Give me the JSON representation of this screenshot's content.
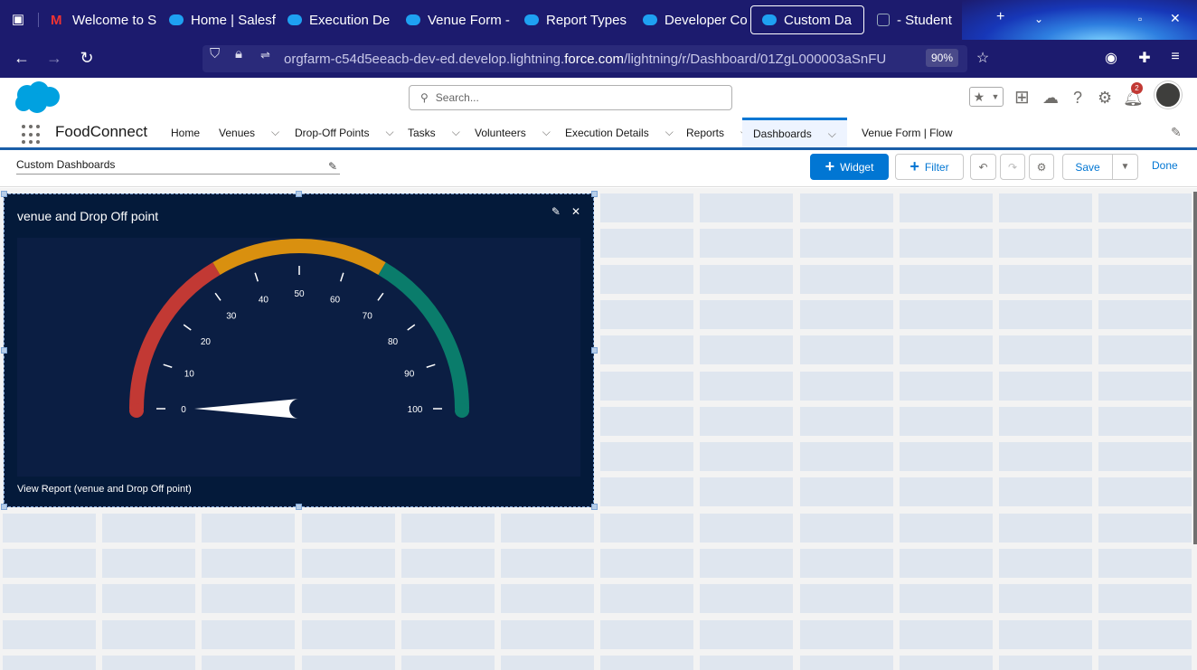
{
  "browser": {
    "tabs": [
      {
        "label": "Welcome to S",
        "icon": "gmail-icon"
      },
      {
        "label": "Home | Salesf",
        "icon": "salesforce-icon"
      },
      {
        "label": "Execution De",
        "icon": "salesforce-icon"
      },
      {
        "label": "Venue Form -",
        "icon": "salesforce-icon"
      },
      {
        "label": "Report Types",
        "icon": "salesforce-icon"
      },
      {
        "label": "Developer Co",
        "icon": "salesforce-icon"
      },
      {
        "label": "Custom Da",
        "icon": "salesforce-icon",
        "active": true
      },
      {
        "label": "- Student",
        "icon": "student-icon"
      }
    ],
    "url_prefix": "orgfarm-c54d5eeacb-dev-ed.develop.lightning.",
    "url_domain": "force.com",
    "url_suffix": "/lightning/r/Dashboard/01ZgL000003aSnFU",
    "zoom": "90%"
  },
  "header": {
    "search_placeholder": "Search...",
    "notification_count": "2"
  },
  "appnav": {
    "app_name": "FoodConnect",
    "items": [
      {
        "label": "Home",
        "dropdown": false
      },
      {
        "label": "Venues",
        "dropdown": true
      },
      {
        "label": "Drop-Off Points",
        "dropdown": true
      },
      {
        "label": "Tasks",
        "dropdown": true
      },
      {
        "label": "Volunteers",
        "dropdown": true
      },
      {
        "label": "Execution Details",
        "dropdown": true
      },
      {
        "label": "Reports",
        "dropdown": true
      },
      {
        "label": "Dashboards",
        "dropdown": true,
        "active": true
      },
      {
        "label": "Venue Form | Flow",
        "dropdown": false
      }
    ]
  },
  "toolbar": {
    "dashboard_name": "Custom Dashboards",
    "widget_label": "Widget",
    "filter_label": "Filter",
    "save_label": "Save",
    "done_label": "Done"
  },
  "widget": {
    "title": "venue and Drop Off point",
    "footer_link": "View Report (venue and Drop Off point)"
  },
  "chart_data": {
    "type": "gauge",
    "min": 0,
    "max": 100,
    "value": 0,
    "tick_labels": [
      "0",
      "10",
      "20",
      "30",
      "40",
      "50",
      "60",
      "70",
      "80",
      "90",
      "100"
    ],
    "bands": [
      {
        "from": 0,
        "to": 33,
        "color": "#c23934"
      },
      {
        "from": 33,
        "to": 67,
        "color": "#d9900f"
      },
      {
        "from": 67,
        "to": 100,
        "color": "#0a7c6b"
      }
    ]
  }
}
